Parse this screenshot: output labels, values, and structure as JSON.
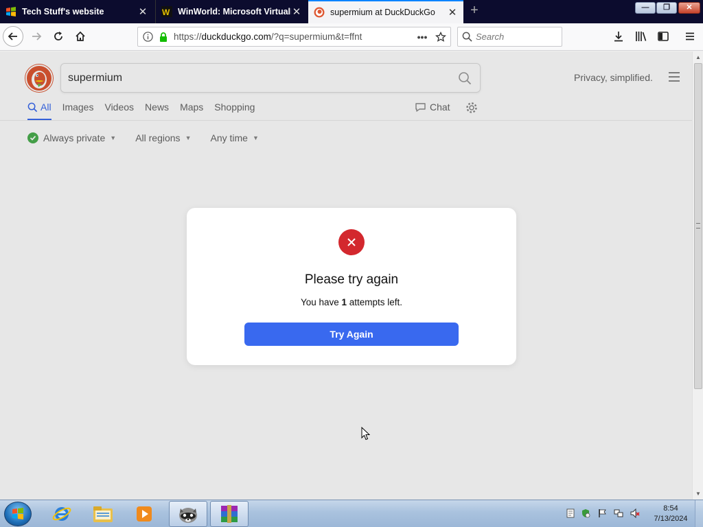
{
  "browser": {
    "tabs": [
      {
        "title": "Tech Stuff's website",
        "favicon": "windows-flag-icon",
        "active": false
      },
      {
        "title": "WinWorld: Microsoft VirtualPC",
        "favicon": "winworld-icon",
        "active": false
      },
      {
        "title": "supermium at DuckDuckGo",
        "favicon": "duckduckgo-icon",
        "active": true
      }
    ],
    "url": {
      "prefix": "https://",
      "domain": "duckduckgo.com",
      "path": "/?q=supermium&t=ffnt"
    },
    "page_actions": "•••",
    "search_placeholder": "Search",
    "accent_color": "#0a84ff"
  },
  "ddg": {
    "query": "supermium",
    "tagline": "Privacy, simplified.",
    "tabs": [
      "All",
      "Images",
      "Videos",
      "News",
      "Maps",
      "Shopping"
    ],
    "active_tab": "All",
    "chat_label": "Chat",
    "filters": [
      "Always private",
      "All regions",
      "Any time"
    ],
    "accent_color": "#3969ef",
    "logo_color": "#de5833"
  },
  "dialog": {
    "title": "Please try again",
    "message_prefix": "You have ",
    "attempts": "1",
    "message_suffix": " attempts left.",
    "button_label": "Try Again",
    "error_color": "#d3282e"
  },
  "taskbar": {
    "apps": [
      "internet-explorer-icon",
      "file-explorer-icon",
      "media-player-icon",
      "raccoon-app-icon",
      "winrar-icon"
    ],
    "active_app": "raccoon-app-icon",
    "clock_time": "8:54",
    "clock_date": "7/13/2024"
  }
}
